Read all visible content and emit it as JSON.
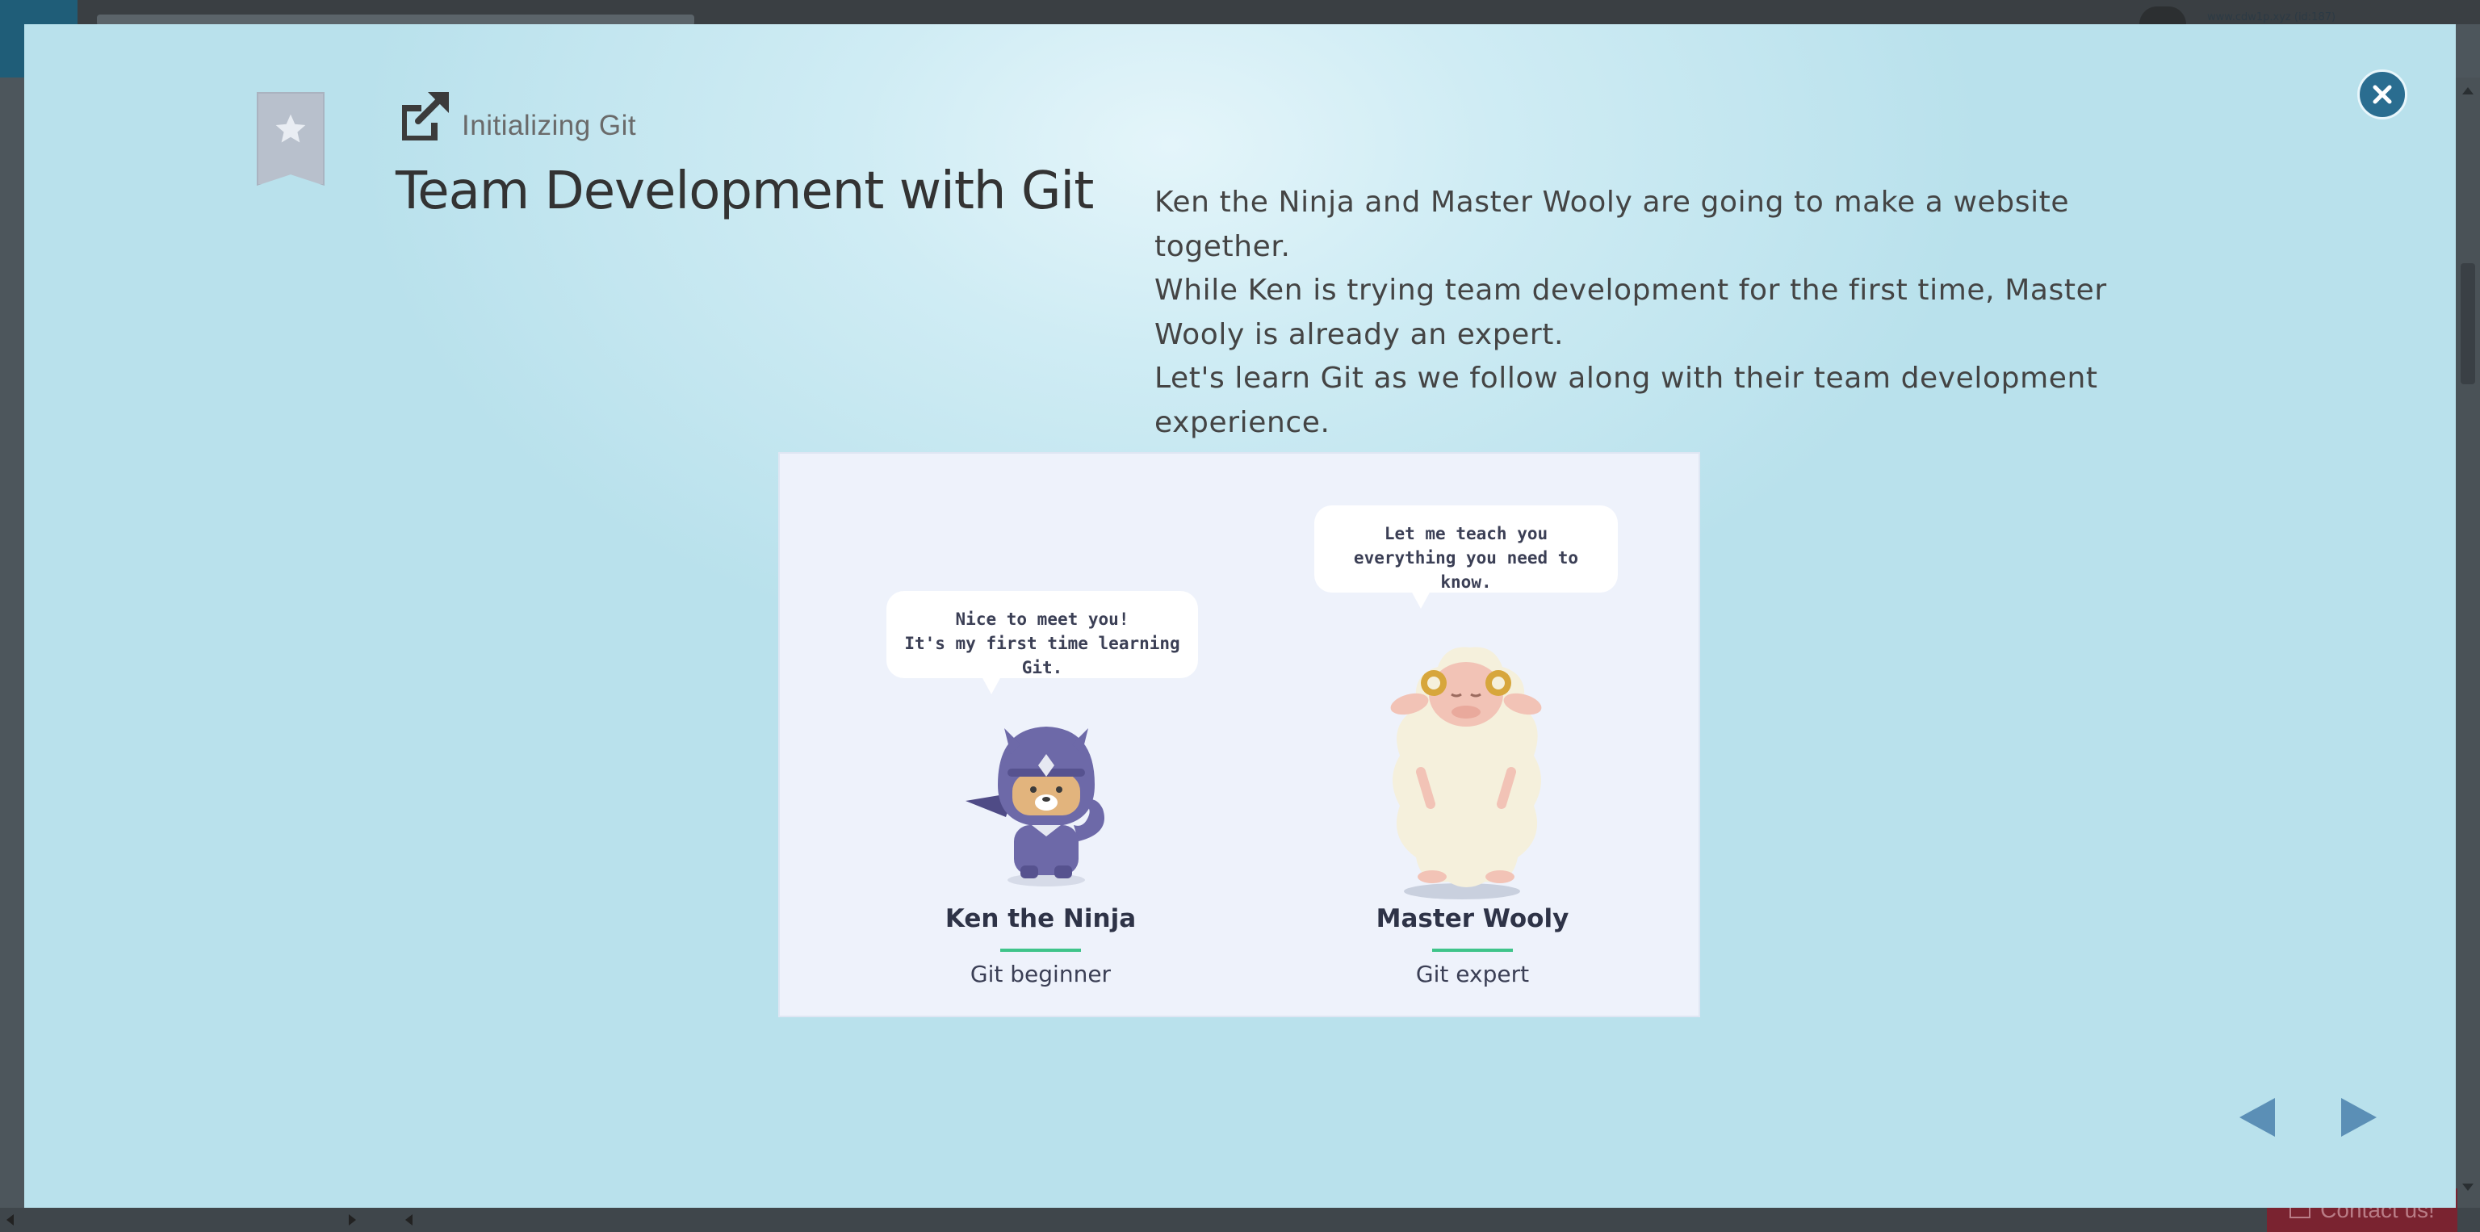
{
  "background": {
    "user_label": "www.cdw1p.xyz (id:187)",
    "contact_label": "Contact us!"
  },
  "lesson": {
    "subtitle": "Initializing Git",
    "title": "Team Development with Git",
    "description": [
      "Ken the Ninja and Master Wooly are going to make a website together.",
      "While Ken is trying team development for the first time, Master Wooly is already an expert.",
      "Let's learn Git as we follow along with their team development experience."
    ]
  },
  "illustration": {
    "ken": {
      "bubble_line1": "Nice to meet you!",
      "bubble_line2": "It's my first time learning Git.",
      "name": "Ken the Ninja",
      "role": "Git beginner"
    },
    "wooly": {
      "bubble_line1": "Let me teach you",
      "bubble_line2": "everything you need to know.",
      "name": "Master Wooly",
      "role": "Git expert"
    }
  },
  "colors": {
    "accent_close": "#2a6d90",
    "nav_arrows": "#5b8fb6",
    "underline_green": "#3fc48a",
    "modal_background": "#cfecf4"
  },
  "icons": {
    "bookmark": "bookmark-star-icon",
    "lesson": "external-link-icon",
    "close": "close-icon",
    "prev": "prev-arrow-icon",
    "next": "next-arrow-icon"
  }
}
